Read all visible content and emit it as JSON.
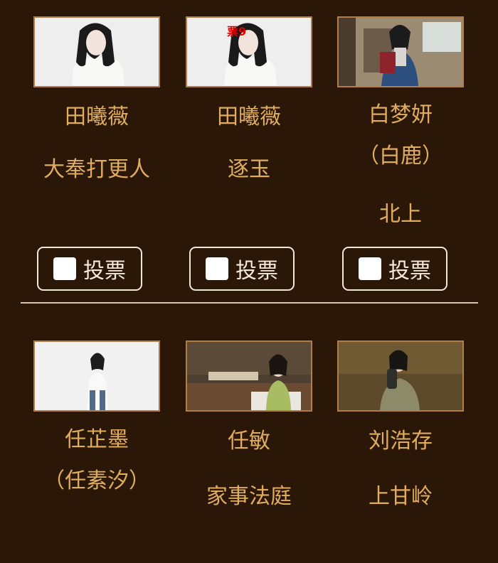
{
  "candidates": [
    {
      "name": "田曦薇",
      "role": "大奉打更人",
      "vote_label": "投票"
    },
    {
      "name": "田曦薇",
      "role": "逐玉",
      "vote_label": "投票",
      "stamp": "票",
      "stamp_suffix": "9"
    },
    {
      "name": "白梦妍\n（白鹿）",
      "role": "北上",
      "vote_label": "投票"
    },
    {
      "name": "任芷墨\n（任素汐）",
      "role": "",
      "vote_label": ""
    },
    {
      "name": "任敏",
      "role": "家事法庭",
      "vote_label": ""
    },
    {
      "name": "刘浩存",
      "role": "上甘岭",
      "vote_label": ""
    }
  ],
  "colors": {
    "background": "#2a1708",
    "text": "#e0ad5f",
    "accent_red": "#e00000"
  }
}
